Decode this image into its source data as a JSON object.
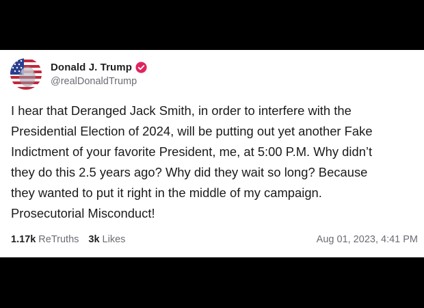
{
  "post": {
    "author": {
      "display_name": "Donald J. Trump",
      "handle": "@realDonaldTrump",
      "verified": true,
      "avatar_icon": "american-flag-portrait"
    },
    "text": "I hear that Deranged Jack Smith, in order to interfere with the\nPresidential Election of 2024, will be putting out yet another Fake\nIndictment of your favorite President, me, at 5:00 P.M. Why didn’t\nthey do this 2.5 years ago? Why did they wait so long? Because\nthey wanted to put it right in the middle of my campaign.\nProsecutorial Misconduct!",
    "stats": {
      "retruths_count": "1.17k",
      "retruths_label": "ReTruths",
      "likes_count": "3k",
      "likes_label": "Likes"
    },
    "timestamp": "Aug 01, 2023, 4:41 PM"
  },
  "colors": {
    "background": "#000000",
    "card": "#ffffff",
    "verified_badge": "#e0245e",
    "muted_text": "#6b6b75"
  }
}
